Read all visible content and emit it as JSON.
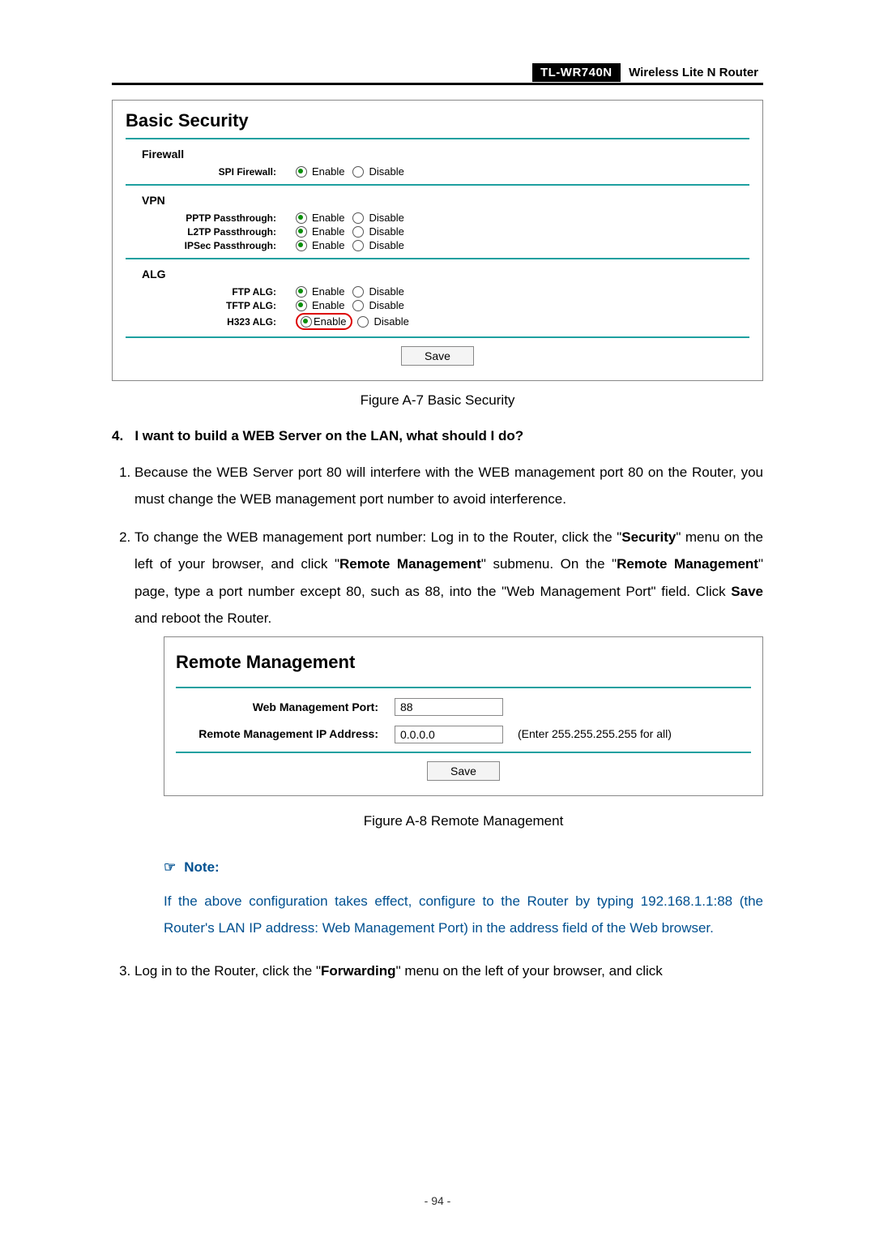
{
  "header": {
    "model": "TL-WR740N",
    "desc": "Wireless  Lite  N  Router"
  },
  "panelA7": {
    "title": "Basic Security",
    "sections": {
      "firewall": {
        "head": "Firewall",
        "spi": {
          "label": "SPI Firewall:",
          "enable": "Enable",
          "disable": "Disable"
        }
      },
      "vpn": {
        "head": "VPN",
        "pptp": {
          "label": "PPTP Passthrough:",
          "enable": "Enable",
          "disable": "Disable"
        },
        "l2tp": {
          "label": "L2TP Passthrough:",
          "enable": "Enable",
          "disable": "Disable"
        },
        "ipsec": {
          "label": "IPSec Passthrough:",
          "enable": "Enable",
          "disable": "Disable"
        }
      },
      "alg": {
        "head": "ALG",
        "ftp": {
          "label": "FTP ALG:",
          "enable": "Enable",
          "disable": "Disable"
        },
        "tftp": {
          "label": "TFTP ALG:",
          "enable": "Enable",
          "disable": "Disable"
        },
        "h323": {
          "label": "H323 ALG:",
          "enable": "Enable",
          "disable": "Disable"
        }
      }
    },
    "save": "Save",
    "caption": "Figure A-7    Basic Security"
  },
  "body": {
    "q4_num": "4.",
    "q4": "I want to build a WEB Server on the LAN, what should I do?",
    "step1": "Because the WEB Server port 80 will interfere with the WEB management port 80 on the Router, you must change the WEB management port number to avoid interference.",
    "step2_a": "To change the WEB management port number: Log in to the Router, click the \"",
    "step2_b": "Security",
    "step2_c": "\" menu on the left of your browser, and click \"",
    "step2_d": "Remote Management",
    "step2_e": "\" submenu. On the \"",
    "step2_f": "Remote Management",
    "step2_g": "\" page, type a port number except 80, such as 88, into the \"Web Management Port\" field. Click ",
    "step2_h": "Save",
    "step2_i": " and reboot the Router.",
    "step3_a": "Log in to the Router, click the \"",
    "step3_b": "Forwarding",
    "step3_c": "\" menu on the left of your browser, and click"
  },
  "panelA8": {
    "title": "Remote Management",
    "port_label": "Web Management Port:",
    "port_value": "88",
    "ip_label": "Remote Management IP Address:",
    "ip_value": "0.0.0.0",
    "ip_hint": "(Enter 255.255.255.255 for all)",
    "save": "Save",
    "caption": "Figure A-8    Remote Management"
  },
  "note": {
    "head": "Note:",
    "body": "If the above configuration takes effect, configure to the Router by typing 192.168.1.1:88 (the Router's LAN IP address: Web Management Port) in the address field of the Web browser."
  },
  "pagenum": "- 94 -"
}
